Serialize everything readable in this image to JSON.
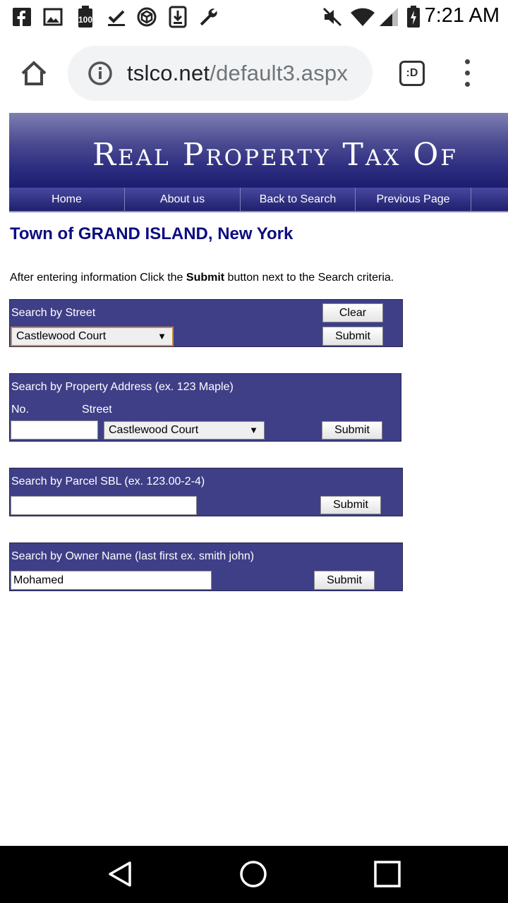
{
  "status_bar": {
    "time": "7:21 AM",
    "icons": [
      "facebook-icon",
      "gallery-icon",
      "battery-100-icon",
      "download-done-icon",
      "cube-icon",
      "download-icon",
      "wrench-icon",
      "mute-icon",
      "wifi-icon",
      "signal-icon",
      "battery-charging-icon"
    ]
  },
  "browser": {
    "url_host": "tslco.net",
    "url_path": "/default3.aspx",
    "tab_count_label": ":D"
  },
  "site": {
    "banner_title": "Real Property Tax Of",
    "nav": [
      "Home",
      "About us",
      "Back to Search",
      "Previous Page"
    ],
    "page_title": "Town of GRAND ISLAND, New York",
    "instructions_pre": "After entering information Click the ",
    "instructions_bold": "Submit",
    "instructions_post": " button next to the Search criteria."
  },
  "street_search": {
    "label": "Search by Street",
    "selected": "Castlewood Court",
    "clear_label": "Clear",
    "submit_label": "Submit"
  },
  "address_search": {
    "label": "Search by Property Address (ex. 123 Maple)",
    "no_label": "No.",
    "street_label": "Street",
    "number_value": "",
    "street_selected": "Castlewood Court",
    "submit_label": "Submit"
  },
  "parcel_search": {
    "label": "Search by Parcel SBL (ex. 123.00-2-4)",
    "value": "",
    "submit_label": "Submit"
  },
  "owner_search": {
    "label": "Search by Owner Name (last first ex. smith john)",
    "value": "Mohamed",
    "submit_label": "Submit"
  },
  "colors": {
    "panel": "#3f3f88",
    "title": "#0d0d80",
    "banner": "#2c2c80"
  }
}
